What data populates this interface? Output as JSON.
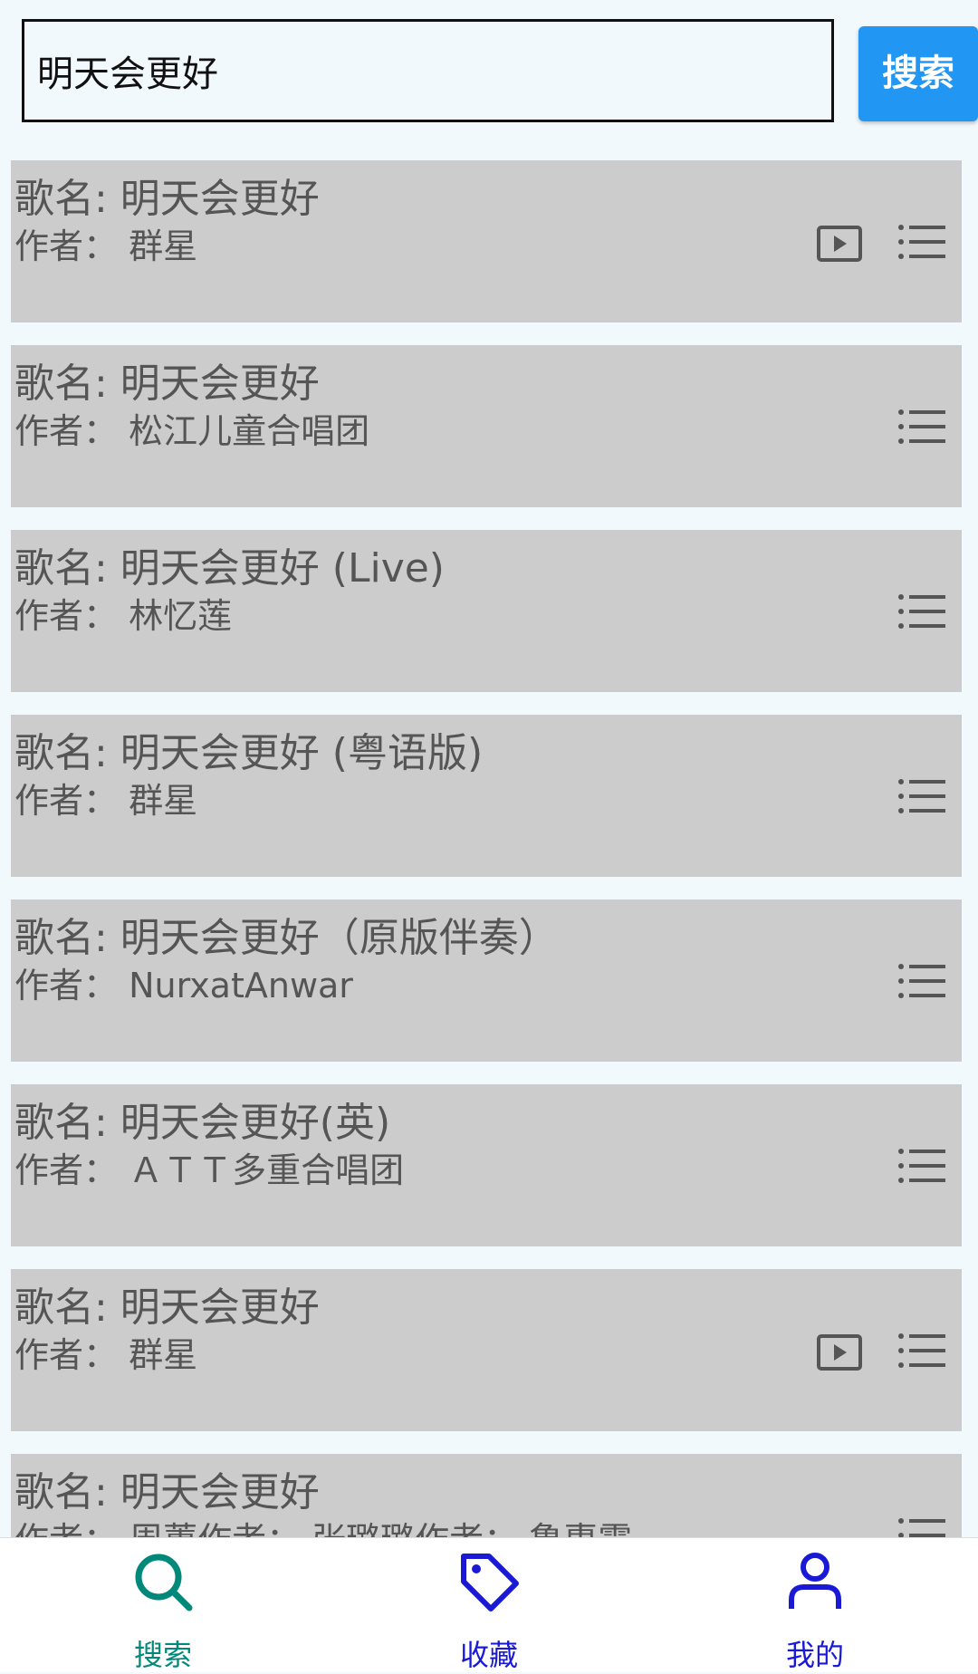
{
  "search": {
    "value": "明天会更好",
    "button_label": "搜索"
  },
  "results": [
    {
      "title": "歌名: 明天会更好",
      "artist": "作者：  群星",
      "has_video": true
    },
    {
      "title": "歌名: 明天会更好",
      "artist": "作者：  松江儿童合唱团",
      "has_video": false
    },
    {
      "title": "歌名: 明天会更好 (Live)",
      "artist": "作者：  林忆莲",
      "has_video": false
    },
    {
      "title": "歌名: 明天会更好 (粤语版)",
      "artist": "作者：  群星",
      "has_video": false
    },
    {
      "title": "歌名: 明天会更好（原版伴奏）",
      "artist": "作者：  NurxatAnwar",
      "has_video": false
    },
    {
      "title": "歌名: 明天会更好(英)",
      "artist": "作者：  ＡＴＴ多重合唱团",
      "has_video": false
    },
    {
      "title": "歌名: 明天会更好",
      "artist": "作者：  群星",
      "has_video": true
    },
    {
      "title": "歌名: 明天会更好",
      "artist": "作者：  周蕙作者：  张璐璐作者：  鲁惠霞",
      "has_video": false
    }
  ],
  "icons": {
    "video": "play-video-icon",
    "playlist": "playlist-icon"
  },
  "nav": {
    "items": [
      {
        "label": "搜索",
        "icon": "search-icon",
        "color": "#00897b"
      },
      {
        "label": "收藏",
        "icon": "tag-icon",
        "color": "#1a1ad6"
      },
      {
        "label": "我的",
        "icon": "person-icon",
        "color": "#1a1ad6"
      }
    ]
  },
  "colors": {
    "background": "#f1f9fd",
    "card": "#cccccc",
    "accent": "#2196f3"
  }
}
